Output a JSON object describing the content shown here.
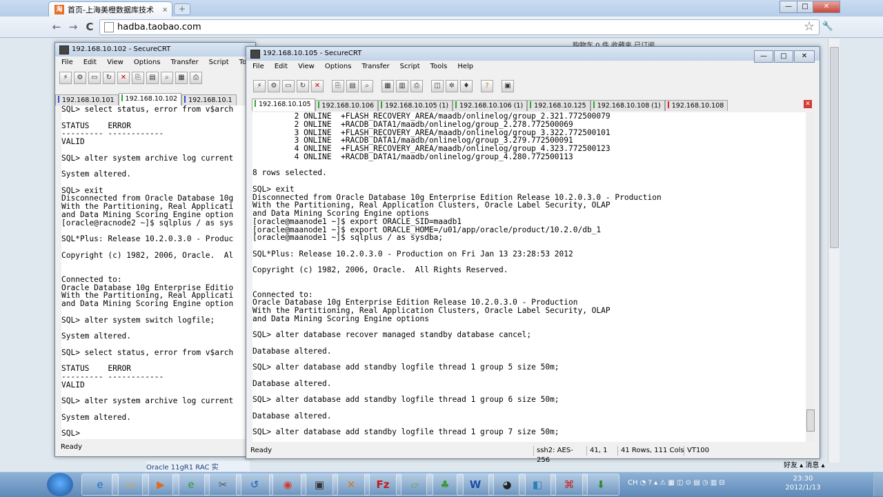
{
  "browser": {
    "tab_title": "首页-上海美橙数据库技术",
    "tab_close": "×",
    "new_tab": "+",
    "url": "hadba.taobao.com",
    "back": "←",
    "forward": "→",
    "reload": "C",
    "star": "☆",
    "wrench": "🔧",
    "win_min": "—",
    "win_max": "□",
    "win_close": "✕",
    "bookmarks_bar": "购物车 0 件   收藏夹   已订阅"
  },
  "crt_back": {
    "title": "192.168.10.102 - SecureCRT",
    "menu": [
      "File",
      "Edit",
      "View",
      "Options",
      "Transfer",
      "Script",
      "Tools"
    ],
    "tabs": [
      {
        "label": "192.168.10.101",
        "bar": "#2a4fd0",
        "active": false
      },
      {
        "label": "192.168.10.102",
        "bar": "#2aa82a",
        "active": true
      },
      {
        "label": "192.168.10.1",
        "bar": "#2a4fd0",
        "active": false
      }
    ],
    "lines": [
      "SQL> select status, error from v$arch",
      "",
      "STATUS    ERROR",
      "--------- ------------",
      "VALID",
      "",
      "SQL> alter system archive log current",
      "",
      "System altered.",
      "",
      "SQL> exit",
      "Disconnected from Oracle Database 10g",
      "With the Partitioning, Real Applicati",
      "and Data Mining Scoring Engine option",
      "[oracle@racnode2 ~]$ sqlplus / as sys",
      "",
      "SQL*Plus: Release 10.2.0.3.0 - Produc",
      "",
      "Copyright (c) 1982, 2006, Oracle.  Al",
      "",
      "",
      "Connected to:",
      "Oracle Database 10g Enterprise Editio",
      "With the Partitioning, Real Applicati",
      "and Data Mining Scoring Engine option",
      "",
      "SQL> alter system switch logfile;",
      "",
      "System altered.",
      "",
      "SQL> select status, error from v$arch",
      "",
      "STATUS    ERROR",
      "--------- ------------",
      "VALID",
      "",
      "SQL> alter system archive log current",
      "",
      "System altered.",
      "",
      "SQL>"
    ],
    "status": "Ready"
  },
  "crt_front": {
    "title": "192.168.10.105 - SecureCRT",
    "menu": [
      "File",
      "Edit",
      "View",
      "Options",
      "Transfer",
      "Script",
      "Tools",
      "Help"
    ],
    "tabs": [
      {
        "label": "192.168.10.105",
        "bar": "#2aa82a",
        "active": true
      },
      {
        "label": "192.168.10.106",
        "bar": "#2aa82a",
        "active": false
      },
      {
        "label": "192.168.10.105 (1)",
        "bar": "#2aa82a",
        "active": false
      },
      {
        "label": "192.168.10.106 (1)",
        "bar": "#2aa82a",
        "active": false
      },
      {
        "label": "192.168.10.125",
        "bar": "#2aa82a",
        "active": false
      },
      {
        "label": "192.168.10.108 (1)",
        "bar": "#2aa82a",
        "active": false
      },
      {
        "label": "192.168.10.108",
        "bar": "#d02a2a",
        "active": false
      }
    ],
    "tab_close": "✕",
    "lines": [
      "         2 ONLINE  +FLASH_RECOVERY_AREA/maadb/onlinelog/group_2.321.772500079",
      "         2 ONLINE  +RACDB_DATA1/maadb/onlinelog/group_2.278.772500069",
      "         3 ONLINE  +FLASH_RECOVERY_AREA/maadb/onlinelog/group_3.322.772500101",
      "         3 ONLINE  +RACDB_DATA1/maadb/onlinelog/group_3.279.772500091",
      "         4 ONLINE  +FLASH_RECOVERY_AREA/maadb/onlinelog/group_4.323.772500123",
      "         4 ONLINE  +RACDB_DATA1/maadb/onlinelog/group_4.280.772500113",
      "",
      "8 rows selected.",
      "",
      "SQL> exit",
      "Disconnected from Oracle Database 10g Enterprise Edition Release 10.2.0.3.0 - Production",
      "With the Partitioning, Real Application Clusters, Oracle Label Security, OLAP",
      "and Data Mining Scoring Engine options",
      "[oracle@maanode1 ~]$ export ORACLE_SID=maadb1",
      "[oracle@maanode1 ~]$ export ORACLE_HOME=/u01/app/oracle/product/10.2.0/db_1",
      "[oracle@maanode1 ~]$ sqlplus / as sysdba;",
      "",
      "SQL*Plus: Release 10.2.0.3.0 - Production on Fri Jan 13 23:28:53 2012",
      "",
      "Copyright (c) 1982, 2006, Oracle.  All Rights Reserved.",
      "",
      "",
      "Connected to:",
      "Oracle Database 10g Enterprise Edition Release 10.2.0.3.0 - Production",
      "With the Partitioning, Real Application Clusters, Oracle Label Security, OLAP",
      "and Data Mining Scoring Engine options",
      "",
      "SQL> alter database recover managed standby database cancel;",
      "",
      "Database altered.",
      "",
      "SQL> alter database add standby logfile thread 1 group 5 size 50m;",
      "",
      "Database altered.",
      "",
      "SQL> alter database add standby logfile thread 1 group 6 size 50m;",
      "",
      "Database altered.",
      "",
      "SQL> alter database add standby logfile thread 1 group 7 size 50m;"
    ],
    "status": {
      "ready": "Ready",
      "cipher": "ssh2: AES-256",
      "cursor": "41,  1",
      "size": "41 Rows, 111 Cols",
      "emulation": "VT100"
    }
  },
  "taskbar": {
    "preview": "Oracle 11gR1 RAC 实",
    "right_text": "好友 ▴  消息 ▴",
    "tray": "CH  ◔  ?  ▴   ⚠  ▦  ◫  ⊙  ▤  ◷  ▥  ⊟",
    "time": "23:30",
    "date": "2012/1/13"
  }
}
